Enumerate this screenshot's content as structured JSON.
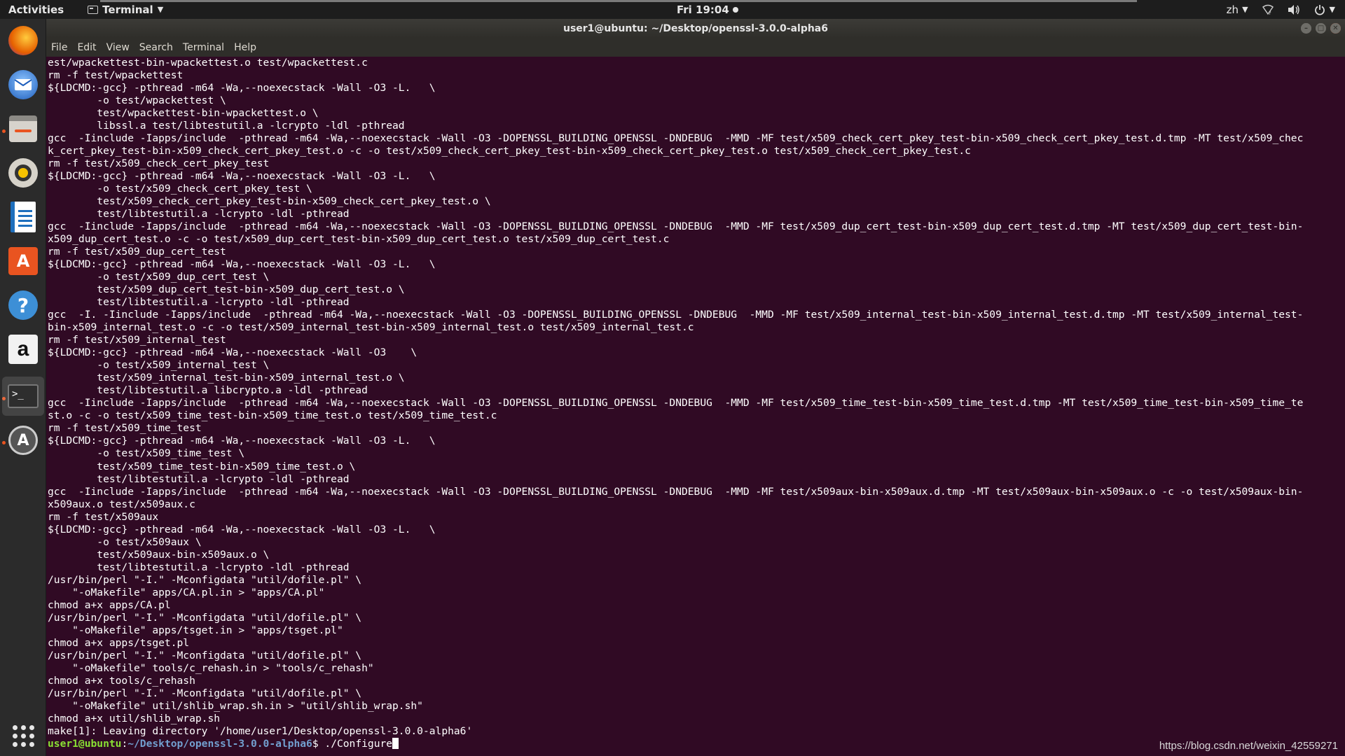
{
  "topbar": {
    "activities": "Activities",
    "app_menu": "Terminal",
    "clock": "Fri 19:04",
    "lang": "zh",
    "right_icons": [
      "network-icon",
      "volume-icon",
      "power-icon"
    ]
  },
  "dock": {
    "items": [
      "firefox-icon",
      "thunderbird-icon",
      "files-icon",
      "rhythmbox-icon",
      "libreoffice-writer-icon",
      "software-center-icon",
      "help-icon",
      "amazon-icon",
      "terminal-icon",
      "software-updater-icon"
    ],
    "show_apps": "show-applications-icon"
  },
  "window": {
    "title": "user1@ubuntu: ~/Desktop/openssl-3.0.0-alpha6",
    "menu": [
      "File",
      "Edit",
      "View",
      "Search",
      "Terminal",
      "Help"
    ]
  },
  "terminal": {
    "lines": [
      "est/wpackettest-bin-wpackettest.o test/wpackettest.c",
      "rm -f test/wpackettest",
      "${LDCMD:-gcc} -pthread -m64 -Wa,--noexecstack -Wall -O3 -L.   \\",
      "        -o test/wpackettest \\",
      "        test/wpackettest-bin-wpackettest.o \\",
      "        libssl.a test/libtestutil.a -lcrypto -ldl -pthread",
      "gcc  -Iinclude -Iapps/include  -pthread -m64 -Wa,--noexecstack -Wall -O3 -DOPENSSL_BUILDING_OPENSSL -DNDEBUG  -MMD -MF test/x509_check_cert_pkey_test-bin-x509_check_cert_pkey_test.d.tmp -MT test/x509_chec",
      "k_cert_pkey_test-bin-x509_check_cert_pkey_test.o -c -o test/x509_check_cert_pkey_test-bin-x509_check_cert_pkey_test.o test/x509_check_cert_pkey_test.c",
      "rm -f test/x509_check_cert_pkey_test",
      "${LDCMD:-gcc} -pthread -m64 -Wa,--noexecstack -Wall -O3 -L.   \\",
      "        -o test/x509_check_cert_pkey_test \\",
      "        test/x509_check_cert_pkey_test-bin-x509_check_cert_pkey_test.o \\",
      "        test/libtestutil.a -lcrypto -ldl -pthread",
      "gcc  -Iinclude -Iapps/include  -pthread -m64 -Wa,--noexecstack -Wall -O3 -DOPENSSL_BUILDING_OPENSSL -DNDEBUG  -MMD -MF test/x509_dup_cert_test-bin-x509_dup_cert_test.d.tmp -MT test/x509_dup_cert_test-bin-",
      "x509_dup_cert_test.o -c -o test/x509_dup_cert_test-bin-x509_dup_cert_test.o test/x509_dup_cert_test.c",
      "rm -f test/x509_dup_cert_test",
      "${LDCMD:-gcc} -pthread -m64 -Wa,--noexecstack -Wall -O3 -L.   \\",
      "        -o test/x509_dup_cert_test \\",
      "        test/x509_dup_cert_test-bin-x509_dup_cert_test.o \\",
      "        test/libtestutil.a -lcrypto -ldl -pthread",
      "gcc  -I. -Iinclude -Iapps/include  -pthread -m64 -Wa,--noexecstack -Wall -O3 -DOPENSSL_BUILDING_OPENSSL -DNDEBUG  -MMD -MF test/x509_internal_test-bin-x509_internal_test.d.tmp -MT test/x509_internal_test-",
      "bin-x509_internal_test.o -c -o test/x509_internal_test-bin-x509_internal_test.o test/x509_internal_test.c",
      "rm -f test/x509_internal_test",
      "${LDCMD:-gcc} -pthread -m64 -Wa,--noexecstack -Wall -O3    \\",
      "        -o test/x509_internal_test \\",
      "        test/x509_internal_test-bin-x509_internal_test.o \\",
      "        test/libtestutil.a libcrypto.a -ldl -pthread",
      "gcc  -Iinclude -Iapps/include  -pthread -m64 -Wa,--noexecstack -Wall -O3 -DOPENSSL_BUILDING_OPENSSL -DNDEBUG  -MMD -MF test/x509_time_test-bin-x509_time_test.d.tmp -MT test/x509_time_test-bin-x509_time_te",
      "st.o -c -o test/x509_time_test-bin-x509_time_test.o test/x509_time_test.c",
      "rm -f test/x509_time_test",
      "${LDCMD:-gcc} -pthread -m64 -Wa,--noexecstack -Wall -O3 -L.   \\",
      "        -o test/x509_time_test \\",
      "        test/x509_time_test-bin-x509_time_test.o \\",
      "        test/libtestutil.a -lcrypto -ldl -pthread",
      "gcc  -Iinclude -Iapps/include  -pthread -m64 -Wa,--noexecstack -Wall -O3 -DOPENSSL_BUILDING_OPENSSL -DNDEBUG  -MMD -MF test/x509aux-bin-x509aux.d.tmp -MT test/x509aux-bin-x509aux.o -c -o test/x509aux-bin-",
      "x509aux.o test/x509aux.c",
      "rm -f test/x509aux",
      "${LDCMD:-gcc} -pthread -m64 -Wa,--noexecstack -Wall -O3 -L.   \\",
      "        -o test/x509aux \\",
      "        test/x509aux-bin-x509aux.o \\",
      "        test/libtestutil.a -lcrypto -ldl -pthread",
      "/usr/bin/perl \"-I.\" -Mconfigdata \"util/dofile.pl\" \\",
      "    \"-oMakefile\" apps/CA.pl.in > \"apps/CA.pl\"",
      "chmod a+x apps/CA.pl",
      "/usr/bin/perl \"-I.\" -Mconfigdata \"util/dofile.pl\" \\",
      "    \"-oMakefile\" apps/tsget.in > \"apps/tsget.pl\"",
      "chmod a+x apps/tsget.pl",
      "/usr/bin/perl \"-I.\" -Mconfigdata \"util/dofile.pl\" \\",
      "    \"-oMakefile\" tools/c_rehash.in > \"tools/c_rehash\"",
      "chmod a+x tools/c_rehash",
      "/usr/bin/perl \"-I.\" -Mconfigdata \"util/dofile.pl\" \\",
      "    \"-oMakefile\" util/shlib_wrap.sh.in > \"util/shlib_wrap.sh\"",
      "chmod a+x util/shlib_wrap.sh",
      "make[1]: Leaving directory '/home/user1/Desktop/openssl-3.0.0-alpha6'"
    ],
    "prompt_user": "user1@ubuntu",
    "prompt_sep": ":",
    "prompt_path": "~/Desktop/openssl-3.0.0-alpha6",
    "prompt_symbol": "$ ",
    "command": "./Configure"
  },
  "watermark": "https://blog.csdn.net/weixin_42559271"
}
